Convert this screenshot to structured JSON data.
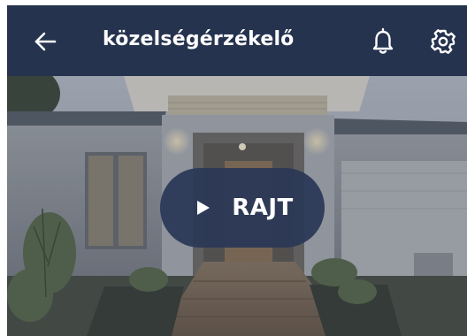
{
  "header": {
    "title": "közelségérzékelő",
    "back_icon": "arrow-left-icon",
    "notifications_icon": "bell-icon",
    "settings_icon": "gear-icon",
    "background": "#26334f"
  },
  "video": {
    "play_label": "RAJT",
    "play_icon": "play-icon"
  }
}
